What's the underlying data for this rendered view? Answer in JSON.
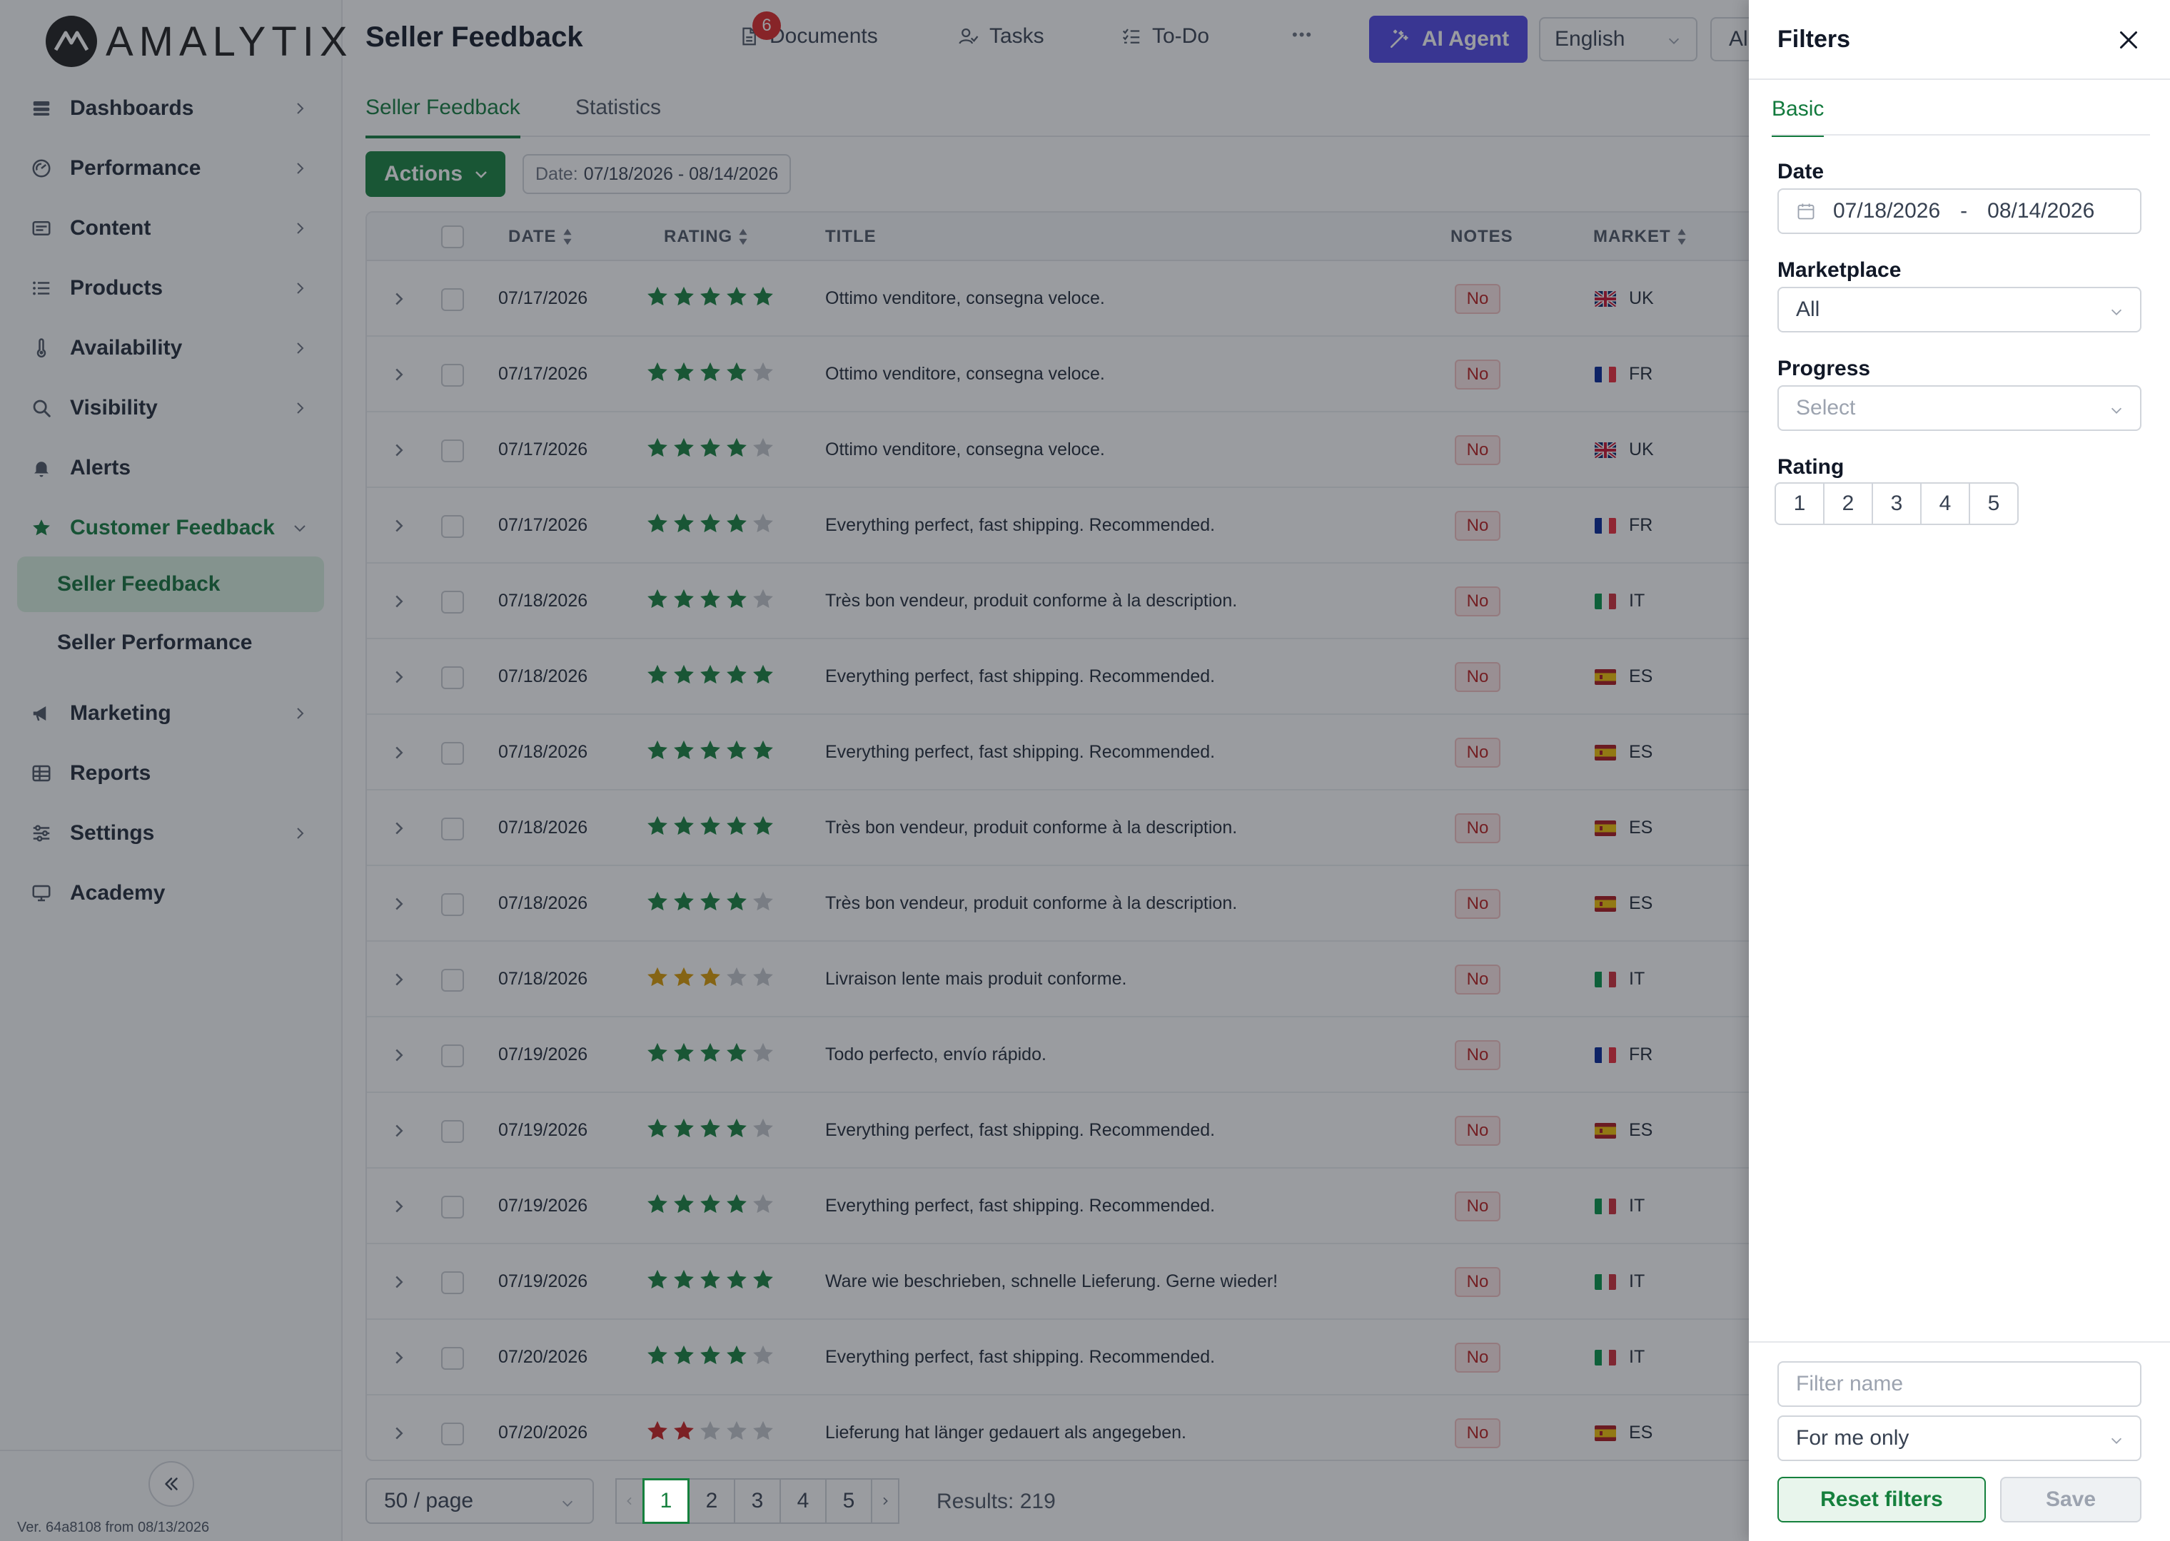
{
  "app": {
    "logo_text": "AMALYTIX",
    "version": "Ver. 64a8108 from 08/13/2026"
  },
  "sidebar": {
    "items": [
      {
        "label": "Dashboards",
        "icon": "dashboard-icon"
      },
      {
        "label": "Performance",
        "icon": "performance-icon"
      },
      {
        "label": "Content",
        "icon": "content-icon"
      },
      {
        "label": "Products",
        "icon": "list-icon"
      },
      {
        "label": "Availability",
        "icon": "thermometer-icon"
      },
      {
        "label": "Visibility",
        "icon": "search-icon"
      },
      {
        "label": "Alerts",
        "icon": "bell-icon"
      },
      {
        "label": "Customer Feedback",
        "icon": "star-icon",
        "expanded": true
      },
      {
        "label": "Marketing",
        "icon": "megaphone-icon"
      },
      {
        "label": "Reports",
        "icon": "table-icon"
      },
      {
        "label": "Settings",
        "icon": "sliders-icon"
      },
      {
        "label": "Academy",
        "icon": "academy-icon"
      }
    ],
    "subitems": [
      {
        "label": "Seller Feedback",
        "active": true
      },
      {
        "label": "Seller Performance",
        "active": false
      }
    ]
  },
  "header": {
    "title": "Seller Feedback",
    "documents_label": "Documents",
    "documents_badge": "6",
    "tasks_label": "Tasks",
    "todo_label": "To-Do",
    "more_label": "•••",
    "ai_agent_label": "AI Agent",
    "language": "English",
    "extra_select": "Al"
  },
  "tabs": [
    {
      "label": "Seller Feedback",
      "active": true
    },
    {
      "label": "Statistics",
      "active": false
    }
  ],
  "toolbar": {
    "actions_label": "Actions",
    "date_chip_label": "Date:",
    "date_chip_value": "07/18/2026 - 08/14/2026"
  },
  "table": {
    "columns": {
      "date": "DATE",
      "rating": "RATING",
      "title": "TITLE",
      "notes": "NOTES",
      "market": "MARKET"
    },
    "rows": [
      {
        "date": "07/17/2026",
        "rating": 5,
        "title": "Ottimo venditore, consegna veloce.",
        "notes": "No",
        "market": "UK"
      },
      {
        "date": "07/17/2026",
        "rating": 4,
        "title": "Ottimo venditore, consegna veloce.",
        "notes": "No",
        "market": "FR"
      },
      {
        "date": "07/17/2026",
        "rating": 4,
        "title": "Ottimo venditore, consegna veloce.",
        "notes": "No",
        "market": "UK"
      },
      {
        "date": "07/17/2026",
        "rating": 4,
        "title": "Everything perfect, fast shipping. Recommended.",
        "notes": "No",
        "market": "FR"
      },
      {
        "date": "07/18/2026",
        "rating": 4,
        "title": "Très bon vendeur, produit conforme à la description.",
        "notes": "No",
        "market": "IT"
      },
      {
        "date": "07/18/2026",
        "rating": 5,
        "title": "Everything perfect, fast shipping. Recommended.",
        "notes": "No",
        "market": "ES"
      },
      {
        "date": "07/18/2026",
        "rating": 5,
        "title": "Everything perfect, fast shipping. Recommended.",
        "notes": "No",
        "market": "ES"
      },
      {
        "date": "07/18/2026",
        "rating": 5,
        "title": "Très bon vendeur, produit conforme à la description.",
        "notes": "No",
        "market": "ES"
      },
      {
        "date": "07/18/2026",
        "rating": 4,
        "title": "Très bon vendeur, produit conforme à la description.",
        "notes": "No",
        "market": "ES"
      },
      {
        "date": "07/18/2026",
        "rating": 3,
        "title": "Livraison lente mais produit conforme.",
        "notes": "No",
        "market": "IT"
      },
      {
        "date": "07/19/2026",
        "rating": 4,
        "title": "Todo perfecto, envío rápido.",
        "notes": "No",
        "market": "FR"
      },
      {
        "date": "07/19/2026",
        "rating": 4,
        "title": "Everything perfect, fast shipping. Recommended.",
        "notes": "No",
        "market": "ES"
      },
      {
        "date": "07/19/2026",
        "rating": 4,
        "title": "Everything perfect, fast shipping. Recommended.",
        "notes": "No",
        "market": "IT"
      },
      {
        "date": "07/19/2026",
        "rating": 5,
        "title": "Ware wie beschrieben, schnelle Lieferung. Gerne wieder!",
        "notes": "No",
        "market": "IT"
      },
      {
        "date": "07/20/2026",
        "rating": 4,
        "title": "Everything perfect, fast shipping. Recommended.",
        "notes": "No",
        "market": "IT"
      },
      {
        "date": "07/20/2026",
        "rating": 2,
        "title": "Lieferung hat länger gedauert als angegeben.",
        "notes": "No",
        "market": "ES"
      }
    ]
  },
  "pagination": {
    "per_page": "50 / page",
    "pages": [
      "1",
      "2",
      "3",
      "4",
      "5"
    ],
    "current": "1",
    "results": "Results: 219"
  },
  "filters": {
    "title": "Filters",
    "tab": "Basic",
    "date_label": "Date",
    "date_from": "07/18/2026",
    "date_sep": "-",
    "date_to": "08/14/2026",
    "marketplace_label": "Marketplace",
    "marketplace_value": "All",
    "progress_label": "Progress",
    "progress_placeholder": "Select",
    "rating_label": "Rating",
    "rating_options": [
      "1",
      "2",
      "3",
      "4",
      "5"
    ],
    "filter_name_placeholder": "Filter name",
    "visibility_value": "For me only",
    "reset_label": "Reset filters",
    "save_label": "Save"
  },
  "colors": {
    "brand_green": "#15803d",
    "ai_button": "#4f46e5",
    "star_green": "#15803d",
    "star_orange": "#d99a00",
    "star_red": "#c81e1e",
    "star_empty": "#c4c7cc",
    "badge_red": "#dc2626"
  }
}
